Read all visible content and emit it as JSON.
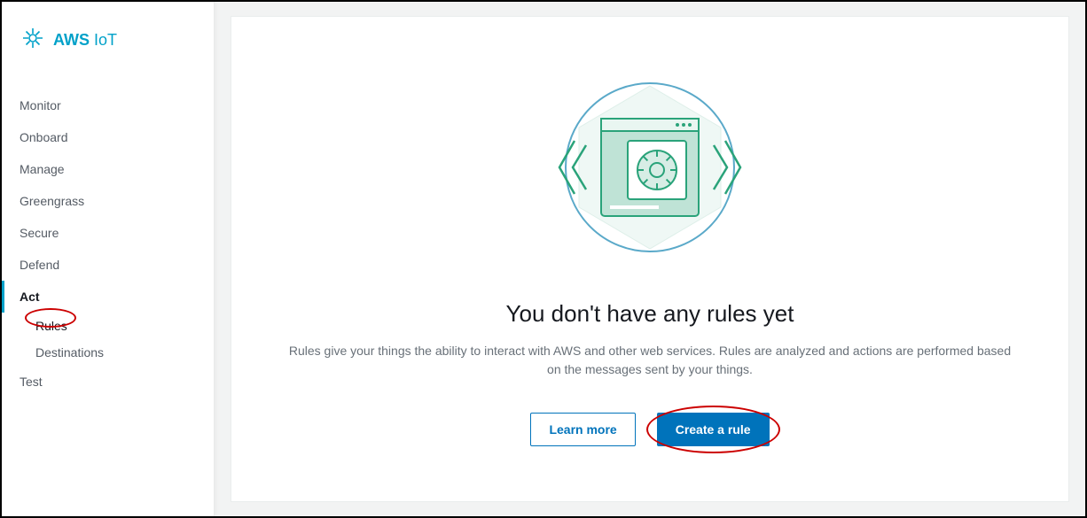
{
  "brand": {
    "bold": "AWS",
    "light": " IoT"
  },
  "sidebar": {
    "items": [
      {
        "label": "Monitor"
      },
      {
        "label": "Onboard"
      },
      {
        "label": "Manage"
      },
      {
        "label": "Greengrass"
      },
      {
        "label": "Secure"
      },
      {
        "label": "Defend"
      },
      {
        "label": "Act",
        "active": true
      },
      {
        "label": "Test"
      }
    ],
    "act_children": [
      {
        "label": "Rules",
        "selected": true
      },
      {
        "label": "Destinations"
      }
    ]
  },
  "empty_state": {
    "title": "You don't have any rules yet",
    "description": "Rules give your things the ability to interact with AWS and other web services. Rules are analyzed and actions are performed based on the messages sent by your things.",
    "learn_more": "Learn more",
    "create": "Create a rule"
  }
}
